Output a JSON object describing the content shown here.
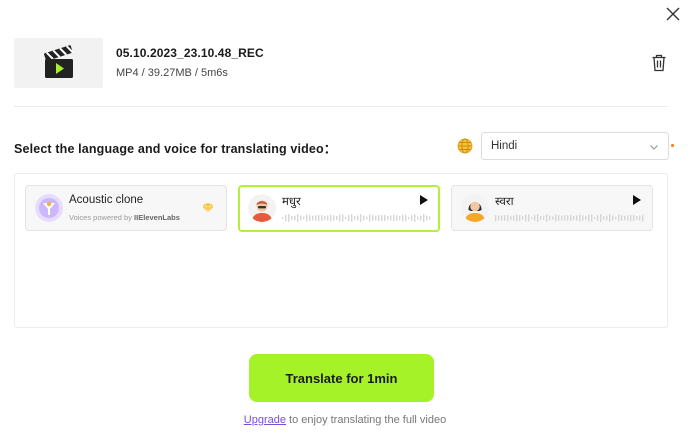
{
  "file": {
    "name": "05.10.2023_23.10.48_REC",
    "meta": "MP4 / 39.27MB / 5m6s"
  },
  "select_label": "Select the language and voice for translating video：",
  "language": {
    "selected": "Hindi"
  },
  "voices": [
    {
      "name": "Acoustic clone",
      "powered_prefix": "Voices powered by ",
      "powered_brand": "IIElevenLabs"
    },
    {
      "name": "मधुर"
    },
    {
      "name": "स्वरा"
    }
  ],
  "translate_button": "Translate for 1min",
  "upgrade": {
    "link": "Upgrade",
    "rest": " to enjoy translating the full video"
  },
  "colors": {
    "accent": "#a4f227",
    "link": "#7a4de0",
    "selected_border": "#b4f03a"
  },
  "icons": [
    "close-icon",
    "clapperboard-icon",
    "trash-icon",
    "globe-icon",
    "chevron-down-icon",
    "diamond-icon",
    "play-icon"
  ]
}
